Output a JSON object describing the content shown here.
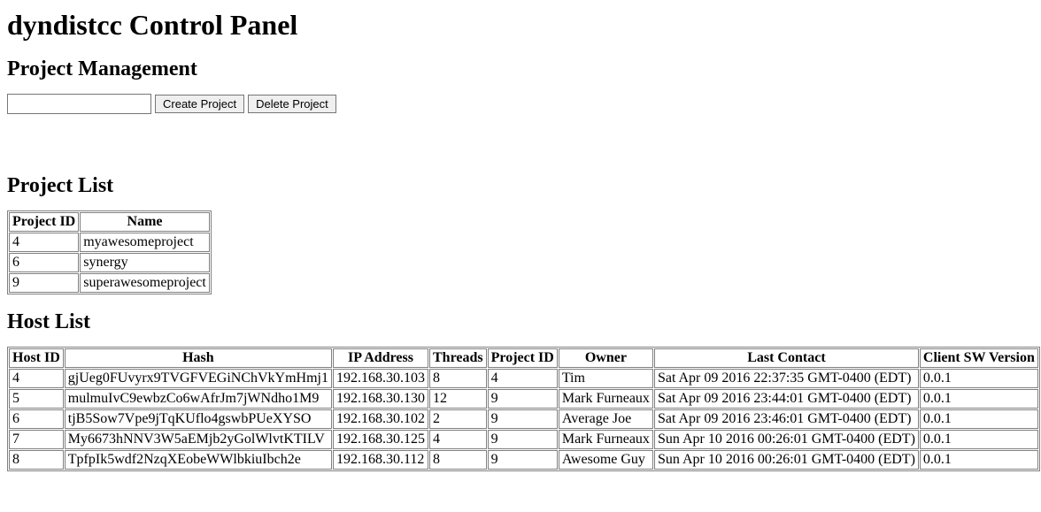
{
  "title": "dyndistcc Control Panel",
  "project_management": {
    "heading": "Project Management",
    "input_value": "",
    "create_label": "Create Project",
    "delete_label": "Delete Project"
  },
  "project_list": {
    "heading": "Project List",
    "headers": {
      "id": "Project ID",
      "name": "Name"
    },
    "rows": [
      {
        "id": "4",
        "name": "myawesomeproject"
      },
      {
        "id": "6",
        "name": "synergy"
      },
      {
        "id": "9",
        "name": "superawesomeproject"
      }
    ]
  },
  "host_list": {
    "heading": "Host List",
    "headers": {
      "host_id": "Host ID",
      "hash": "Hash",
      "ip": "IP Address",
      "threads": "Threads",
      "project_id": "Project ID",
      "owner": "Owner",
      "last_contact": "Last Contact",
      "version": "Client SW Version"
    },
    "rows": [
      {
        "host_id": "4",
        "hash": "gjUeg0FUvyrx9TVGFVEGiNChVkYmHmj1",
        "ip": "192.168.30.103",
        "threads": "8",
        "project_id": "4",
        "owner": "Tim",
        "last_contact": "Sat Apr 09 2016 22:37:35 GMT-0400 (EDT)",
        "version": "0.0.1"
      },
      {
        "host_id": "5",
        "hash": "mulmuIvC9ewbzCo6wAfrJm7jWNdho1M9",
        "ip": "192.168.30.130",
        "threads": "12",
        "project_id": "9",
        "owner": "Mark Furneaux",
        "last_contact": "Sat Apr 09 2016 23:44:01 GMT-0400 (EDT)",
        "version": "0.0.1"
      },
      {
        "host_id": "6",
        "hash": "tjB5Sow7Vpe9jTqKUflo4gswbPUeXYSO",
        "ip": "192.168.30.102",
        "threads": "2",
        "project_id": "9",
        "owner": "Average Joe",
        "last_contact": "Sat Apr 09 2016 23:46:01 GMT-0400 (EDT)",
        "version": "0.0.1"
      },
      {
        "host_id": "7",
        "hash": "My6673hNNV3W5aEMjb2yGolWlvtKTILV",
        "ip": "192.168.30.125",
        "threads": "4",
        "project_id": "9",
        "owner": "Mark Furneaux",
        "last_contact": "Sun Apr 10 2016 00:26:01 GMT-0400 (EDT)",
        "version": "0.0.1"
      },
      {
        "host_id": "8",
        "hash": "TpfpIk5wdf2NzqXEobeWWlbkiuIbch2e",
        "ip": "192.168.30.112",
        "threads": "8",
        "project_id": "9",
        "owner": "Awesome Guy",
        "last_contact": "Sun Apr 10 2016 00:26:01 GMT-0400 (EDT)",
        "version": "0.0.1"
      }
    ]
  }
}
